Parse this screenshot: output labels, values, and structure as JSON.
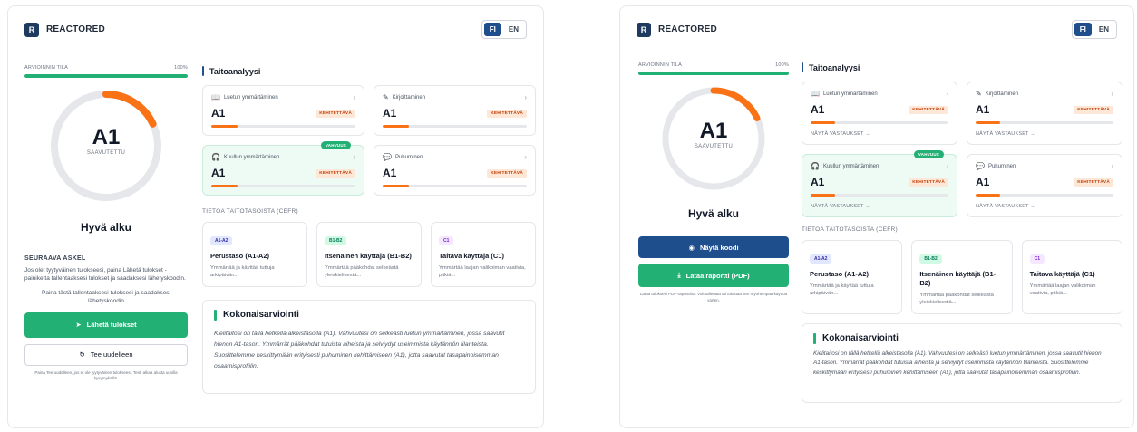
{
  "left": {
    "brand": {
      "logo_letter": "R",
      "name": "REACTORED"
    },
    "lang": {
      "fi": "FI",
      "en": "EN",
      "active": "FI"
    },
    "progress": {
      "label": "ARVIOINNIN TILA",
      "percent_label": "100%",
      "value": 1.0
    },
    "result": {
      "level": "A1",
      "sub": "SAAVUTETTU",
      "ring_fraction": 0.18,
      "headline": "Hyvä alku"
    },
    "next_step": {
      "title": "SEURAAVA ASKEL",
      "text": "Jos olet tyytyväinen tulokseesi, paina Lähetä tulokset -painiketta tallentaaksesi tulokset ja saadaksesi lähetyskoodin.",
      "hint": "Paina tästä tallentaaksesi tuloksesi ja saadaksesi lähetyskoodin"
    },
    "send_button": "Lähetä tulokset",
    "retry_button": "Tee uudelleen",
    "retry_note": "Paina Tee uudelleen, jos et ole tyytyväinen tulokseesi. Testi alkaa alusta uusilla kysymyksillä."
  },
  "right": {
    "brand": {
      "logo_letter": "R",
      "name": "REACTORED"
    },
    "lang": {
      "fi": "FI",
      "en": "EN",
      "active": "FI"
    },
    "progress": {
      "label": "ARVIOINNIN TILA",
      "percent_label": "100%",
      "value": 1.0
    },
    "result": {
      "level": "A1",
      "sub": "SAAVUTETTU",
      "ring_fraction": 0.18,
      "headline": "Hyvä alku"
    },
    "show_code_button": "Näytä koodi",
    "download_button": "Lataa raportti (PDF)",
    "download_note": "Lataa tuloksesi PDF-raporttina. Voit tallentaa tai tulostaa sen myöhempää käyttöä varten.",
    "view_answers": "NÄYTÄ VASTAUKSET →"
  },
  "skills_title": "Taitoanalyysi",
  "skills": [
    {
      "name": "Luetun ymmärtäminen",
      "icon": "book-icon",
      "glyph": "📖",
      "level": "A1",
      "badge": "KEHITETTÄVÄ",
      "fill": 0.18,
      "strong": false
    },
    {
      "name": "Kirjoittaminen",
      "icon": "pencil-icon",
      "glyph": "✎",
      "level": "A1",
      "badge": "KEHITETTÄVÄ",
      "fill": 0.18,
      "strong": false
    },
    {
      "name": "Kuullun ymmärtäminen",
      "icon": "headphones-icon",
      "glyph": "🎧",
      "level": "A1",
      "badge": "KEHITETTÄVÄ",
      "fill": 0.18,
      "strong": true,
      "strong_label": "VAHVUUS"
    },
    {
      "name": "Puhuminen",
      "icon": "speech-bubble-icon",
      "glyph": "💬",
      "level": "A1",
      "badge": "KEHITETTÄVÄ",
      "fill": 0.18,
      "strong": false
    }
  ],
  "cefr_title": "TIETOA TAITOTASOISTA (CEFR)",
  "cefr": [
    {
      "badge": "A1-A2",
      "badge_bg": "#e0e7ff",
      "badge_fg": "#3730a3",
      "name": "Perustaso (A1-A2)",
      "desc": "Ymmärtää ja käyttää tuttuja arkipäivän..."
    },
    {
      "badge": "B1-B2",
      "badge_bg": "#d1fae5",
      "badge_fg": "#047857",
      "name": "Itsenäinen käyttäjä (B1-B2)",
      "desc": "Ymmärtää pääkohdat selkeästä yleiskielisestä..."
    },
    {
      "badge": "C1",
      "badge_bg": "#f3e8ff",
      "badge_fg": "#7e22ce",
      "name": "Taitava käyttäjä (C1)",
      "desc": "Ymmärtää laajan valikoiman vaativia, pitkiä..."
    }
  ],
  "overall": {
    "title": "Kokonaisarviointi",
    "text": "Kielitaitosi on tällä hetkellä alkeistasolla (A1). Vahvuutesi on selkeästi luetun ymmärtäminen, jossa saavutit hienon A1-tason. Ymmärrät pääkohdat tutuista aiheista ja selviydyt useimmista käytännön tilanteista. Suosittelemme keskittymään erityisesti puhuminen kehittämiseen (A1), jotta saavutat tasapainoisemman osaamisprofiilin."
  },
  "colors": {
    "brand_blue": "#1e4e8c",
    "green": "#23b075",
    "orange": "#f97316"
  }
}
